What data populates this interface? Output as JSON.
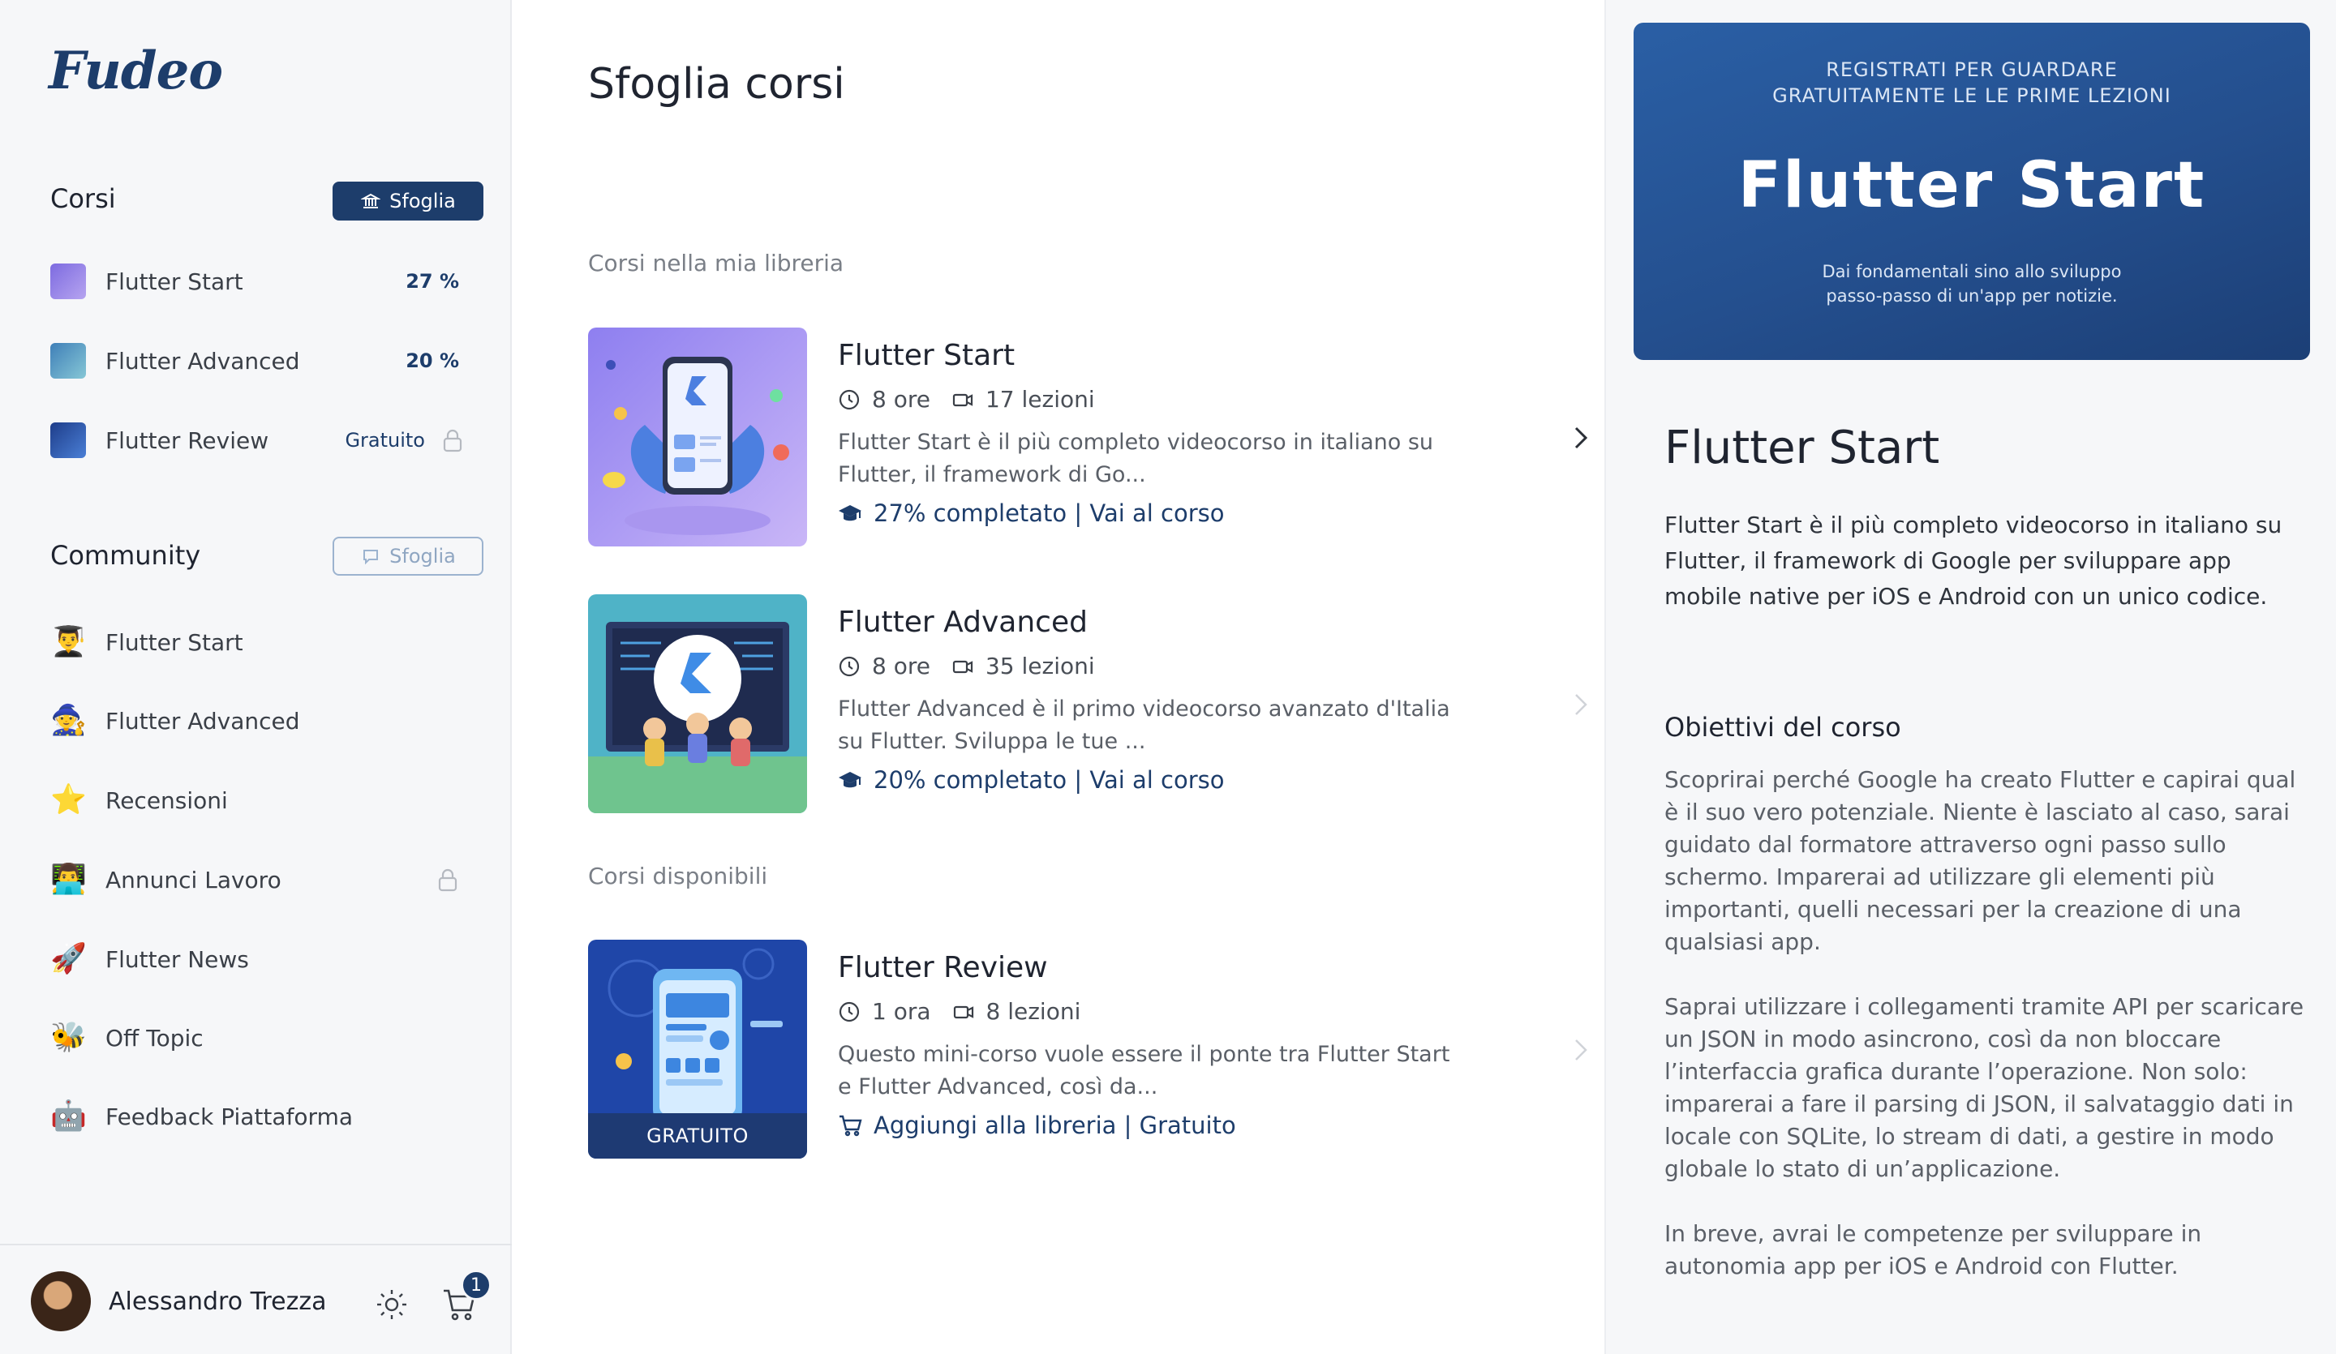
{
  "app": {
    "logo": "Fudeo"
  },
  "sidebar": {
    "courses_title": "Corsi",
    "courses_button": "Sfoglia",
    "courses": [
      {
        "name": "Flutter Start",
        "progress": "27 %",
        "locked": false
      },
      {
        "name": "Flutter Advanced",
        "progress": "20 %",
        "locked": false
      },
      {
        "name": "Flutter Review",
        "progress": "Gratuito",
        "locked": true
      }
    ],
    "community_title": "Community",
    "community_button": "Sfoglia",
    "community": [
      {
        "name": "Flutter Start",
        "emoji": "👨‍🎓",
        "locked": false
      },
      {
        "name": "Flutter Advanced",
        "emoji": "🧙",
        "locked": false
      },
      {
        "name": "Recensioni",
        "emoji": "⭐",
        "locked": false
      },
      {
        "name": "Annunci Lavoro",
        "emoji": "👨‍💻",
        "locked": true
      },
      {
        "name": "Flutter News",
        "emoji": "🚀",
        "locked": false
      },
      {
        "name": "Off Topic",
        "emoji": "🐝",
        "locked": false
      },
      {
        "name": "Feedback Piattaforma",
        "emoji": "🤖",
        "locked": false
      }
    ],
    "user": {
      "name": "Alessandro Trezza",
      "cart_count": "1"
    }
  },
  "main": {
    "title": "Sfoglia corsi",
    "library_title": "Corsi nella mia libreria",
    "available_title": "Corsi disponibili",
    "cards": [
      {
        "title": "Flutter Start",
        "duration": "8 ore",
        "lessons": "17 lezioni",
        "description": "Flutter Start è il più completo videocorso in italiano su Flutter, il framework di Go...",
        "cta": "27% completato | Vai al corso"
      },
      {
        "title": "Flutter Advanced",
        "duration": "8 ore",
        "lessons": "35 lezioni",
        "description": "Flutter Advanced è il primo videocorso avanzato d'Italia su Flutter. Sviluppa le tue ...",
        "cta": "20% completato | Vai al corso"
      },
      {
        "title": "Flutter Review",
        "duration": "1 ora",
        "lessons": "8 lezioni",
        "description": "Questo mini-corso vuole essere il ponte tra Flutter Start e Flutter Advanced, così da...",
        "cta": "Aggiungi alla libreria | Gratuito",
        "badge": "GRATUITO"
      }
    ]
  },
  "panel": {
    "banner_kicker_1": "REGISTRATI PER  GUARDARE",
    "banner_kicker_2": "GRATUITAMENTE LE LE PRIME LEZIONI",
    "banner_title": "Flutter Start",
    "banner_sub_1": "Dai fondamentali sino allo sviluppo",
    "banner_sub_2": "passo-passo di un'app per notizie.",
    "title": "Flutter Start",
    "description": "Flutter Start è il più completo videocorso in italiano su Flutter, il framework di Google per sviluppare app mobile native per iOS e Android con un unico codice.",
    "objectives_title": "Obiettivi del corso",
    "objectives": [
      "Scoprirai perché Google ha creato Flutter e capirai qual è il suo vero potenziale. Niente è lasciato al caso, sarai guidato dal formatore attraverso ogni passo sullo schermo. Imparerai ad utilizzare gli elementi più importanti, quelli necessari per la creazione di una qualsiasi app.",
      "Saprai utilizzare i collegamenti tramite API per scaricare un JSON in modo asincrono, così da non bloccare l’interfaccia grafica durante l’operazione. Non solo: imparerai a fare il parsing di JSON, il salvataggio dati in locale con SQLite, lo stream di dati, a gestire in modo globale lo stato di un’applicazione.",
      "In breve, avrai le competenze per sviluppare in autonomia app per iOS e Android con Flutter."
    ]
  },
  "colors": {
    "brand_navy": "#1d3d6b",
    "banner_blue": "#2a5fa5",
    "muted_text": "#7a7f87"
  }
}
